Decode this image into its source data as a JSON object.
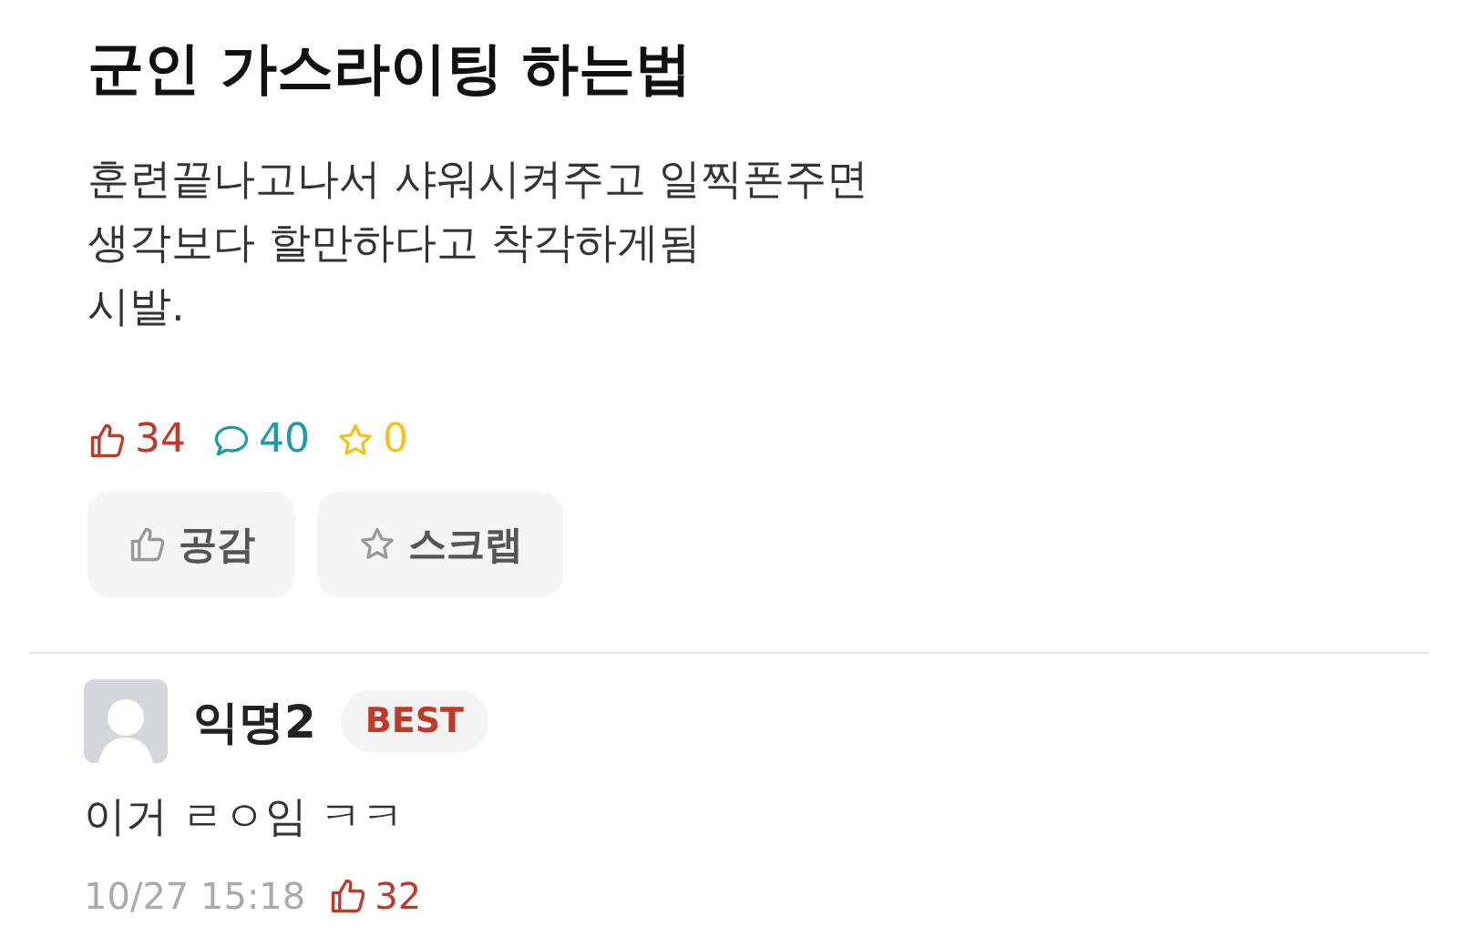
{
  "post": {
    "title": "군인 가스라이팅 하는법",
    "body": "훈련끝나고나서 샤워시켜주고 일찍폰주면\n생각보다 할만하다고 착각하게됨\n시발.",
    "stats": [
      {
        "kind": "like",
        "count": "34",
        "color": "#c0392b"
      },
      {
        "kind": "comment",
        "count": "40",
        "color": "#1f9aa8"
      },
      {
        "kind": "scrap",
        "count": "0",
        "color": "#f0c419"
      }
    ],
    "actions": [
      {
        "kind": "like",
        "label": "공감"
      },
      {
        "kind": "scrap",
        "label": "스크랩"
      }
    ]
  },
  "comments": [
    {
      "author": "익명2",
      "badge": "BEST",
      "text": "이거 ㄹㅇ임 ㅋㅋ",
      "time": "10/27 15:18",
      "likes": "32"
    }
  ]
}
